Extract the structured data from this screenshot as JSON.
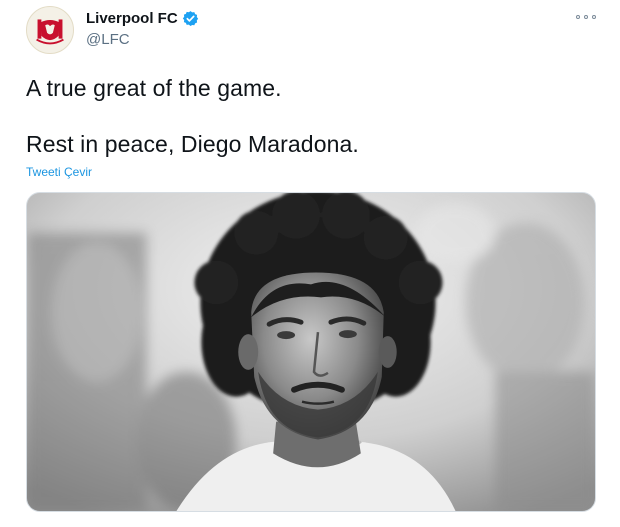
{
  "author": {
    "display_name": "Liverpool FC",
    "handle": "@LFC",
    "verified": true,
    "avatar_icon": "liverbird-crest-icon"
  },
  "tweet": {
    "line1": "A true great of the game.",
    "line2": "Rest in peace, Diego Maradona.",
    "translate_label": "Tweeti Çevir"
  },
  "media": {
    "type": "photo",
    "style": "black-and-white portrait"
  },
  "icons": {
    "verified": "verified-badge-icon",
    "more": "more-options-icon"
  },
  "colors": {
    "link_blue": "#1b95e0",
    "verified_blue": "#1da1f2",
    "crest_red": "#c8102e",
    "handle_gray": "#5b7083"
  }
}
